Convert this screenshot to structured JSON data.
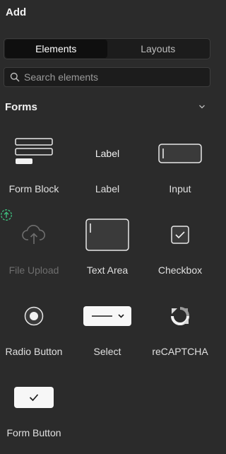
{
  "panel": {
    "title": "Add"
  },
  "tabs": [
    {
      "label": "Elements",
      "active": true
    },
    {
      "label": "Layouts",
      "active": false
    }
  ],
  "search": {
    "placeholder": "Search elements",
    "value": ""
  },
  "section": {
    "title": "Forms",
    "expanded": true
  },
  "elements": [
    {
      "label": "Form Block",
      "icon": "form-block-icon",
      "enabled": true
    },
    {
      "label": "Label",
      "icon": "label-icon",
      "icon_text": "Label",
      "enabled": true
    },
    {
      "label": "Input",
      "icon": "input-icon",
      "enabled": true
    },
    {
      "label": "File Upload",
      "icon": "cloud-upload-icon",
      "enabled": false
    },
    {
      "label": "Text Area",
      "icon": "textarea-icon",
      "enabled": true
    },
    {
      "label": "Checkbox",
      "icon": "checkbox-icon",
      "enabled": true
    },
    {
      "label": "Radio Button",
      "icon": "radio-icon",
      "enabled": true
    },
    {
      "label": "Select",
      "icon": "select-icon",
      "enabled": true
    },
    {
      "label": "reCAPTCHA",
      "icon": "recaptcha-icon",
      "enabled": true
    },
    {
      "label": "Form Button",
      "icon": "form-button-icon",
      "enabled": true
    }
  ],
  "colors": {
    "background": "#2b2b2b",
    "upgrade_badge": "#3fbf7f"
  }
}
